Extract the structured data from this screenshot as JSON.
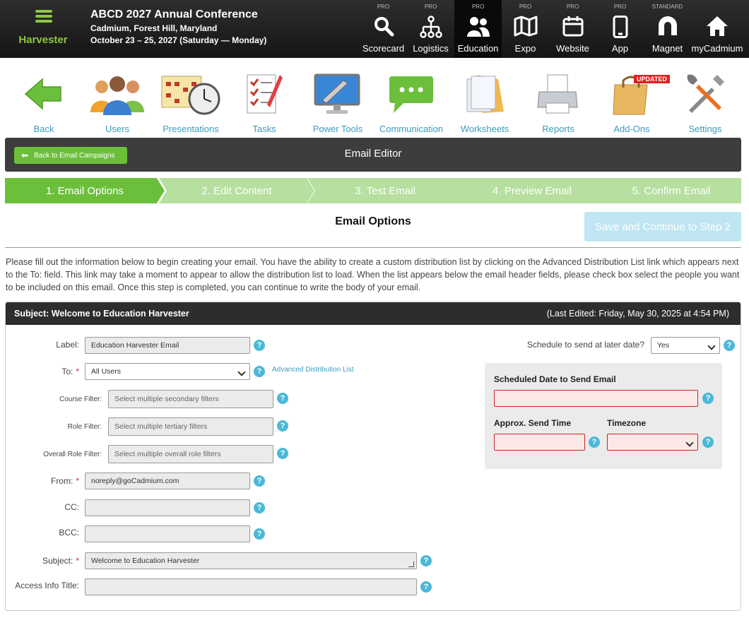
{
  "brand": {
    "name": "Harvester"
  },
  "conference": {
    "title": "ABCD 2027 Annual Conference",
    "location": "Cadmium, Forest Hill, Maryland",
    "dates": "October 23 – 25, 2027 (Saturday — Monday)"
  },
  "modules": [
    {
      "tier": "PRO",
      "label": "Scorecard",
      "icon": "search-icon"
    },
    {
      "tier": "PRO",
      "label": "Logistics",
      "icon": "hierarchy-icon"
    },
    {
      "tier": "PRO",
      "label": "Education",
      "icon": "users-icon",
      "active": true
    },
    {
      "tier": "PRO",
      "label": "Expo",
      "icon": "map-icon"
    },
    {
      "tier": "PRO",
      "label": "Website",
      "icon": "calendar-icon"
    },
    {
      "tier": "PRO",
      "label": "App",
      "icon": "phone-icon"
    },
    {
      "tier": "STANDARD",
      "label": "Magnet",
      "icon": "magnet-icon"
    },
    {
      "tier": "",
      "label": "myCadmium",
      "icon": "home-icon"
    }
  ],
  "tools": [
    {
      "label": "Back",
      "icon": "back-arrow-icon"
    },
    {
      "label": "Users",
      "icon": "people-icon"
    },
    {
      "label": "Presentations",
      "icon": "calendar-clock-icon"
    },
    {
      "label": "Tasks",
      "icon": "checklist-icon"
    },
    {
      "label": "Power Tools",
      "icon": "monitor-tools-icon"
    },
    {
      "label": "Communication",
      "icon": "chat-bubble-icon"
    },
    {
      "label": "Worksheets",
      "icon": "folder-documents-icon"
    },
    {
      "label": "Reports",
      "icon": "printer-icon"
    },
    {
      "label": "Add-Ons",
      "icon": "shopping-bag-icon",
      "badge": "UPDATED"
    },
    {
      "label": "Settings",
      "icon": "wrench-screwdriver-icon"
    }
  ],
  "editor": {
    "back_label": "Back to Email Campaigns",
    "title": "Email Editor"
  },
  "steps": [
    {
      "label": "1. Email Options",
      "active": true
    },
    {
      "label": "2. Edit Content"
    },
    {
      "label": "3. Test Email"
    },
    {
      "label": "4. Preview Email"
    },
    {
      "label": "5. Confirm Email"
    }
  ],
  "options": {
    "title": "Email Options",
    "save_label": "Save and Continue to Step 2",
    "intro": "Please fill out the information below to begin creating your email. You have the ability to create a custom distribution list by clicking on the Advanced Distribution List link which appears next to the To: field. This link may take a moment to appear to allow the distribution list to load. When the list appears below the email header fields, please check box select the people you want to be included on this email. Once this step is completed, you can continue to write the body of your email."
  },
  "panel": {
    "subject_header": "Subject: Welcome to Education Harvester",
    "last_edited": "(Last Edited: Friday, May 30, 2025 at 4:54 PM)"
  },
  "form": {
    "label": {
      "label": "Label:",
      "value": "Education Harvester Email"
    },
    "to": {
      "label": "To:",
      "value": "All Users",
      "link": "Advanced Distribution List"
    },
    "course_filter": {
      "label": "Course Filter:",
      "placeholder": "Select multiple secondary filters"
    },
    "role_filter": {
      "label": "Role Filter:",
      "placeholder": "Select multiple tertiary filters"
    },
    "overall_role_filter": {
      "label": "Overall Role Filter:",
      "placeholder": "Select multiple overall role filters"
    },
    "from": {
      "label": "From:",
      "value": "noreply@goCadmium.com"
    },
    "cc": {
      "label": "CC:",
      "value": ""
    },
    "bcc": {
      "label": "BCC:",
      "value": ""
    },
    "subject": {
      "label": "Subject:",
      "value": "Welcome to Education Harvester"
    },
    "access_info_title": {
      "label": "Access Info Title:",
      "value": ""
    },
    "required_mark": "*",
    "help_glyph": "?"
  },
  "schedule": {
    "label": "Schedule to send at later date?",
    "value": "Yes",
    "date_label": "Scheduled Date to Send Email",
    "time_label": "Approx. Send Time",
    "timezone_label": "Timezone"
  }
}
